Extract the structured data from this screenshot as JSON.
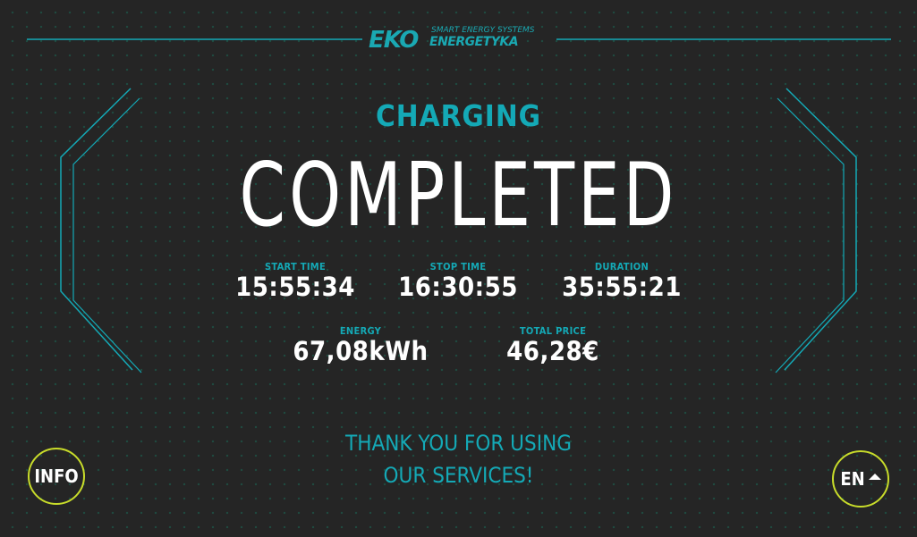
{
  "brand": {
    "logo_main": "EKO",
    "logo_tagline": "SMART ENERGY SYSTEMS",
    "logo_sub": "ENERGETYKA"
  },
  "status": {
    "line1": "CHARGING",
    "line2": "COMPLETED"
  },
  "stats": {
    "start_time": {
      "label": "START TIME",
      "value": "15:55:34"
    },
    "stop_time": {
      "label": "STOP TIME",
      "value": "16:30:55"
    },
    "duration": {
      "label": "DURATION",
      "value": "35:55:21"
    },
    "energy": {
      "label": "ENERGY",
      "value": "67,08kWh"
    },
    "total_price": {
      "label": "TOTAL PRICE",
      "value": "46,28€"
    }
  },
  "message": {
    "line1": "THANK YOU FOR USING",
    "line2": "OUR SERVICES!"
  },
  "buttons": {
    "info": "INFO",
    "language": "EN"
  },
  "colors": {
    "background": "#252525",
    "accent_cyan": "#14a9b6",
    "button_ring": "#c8dc2a",
    "text_primary": "#ffffff"
  },
  "icons": {
    "language_toggle": "caret-up-icon"
  }
}
